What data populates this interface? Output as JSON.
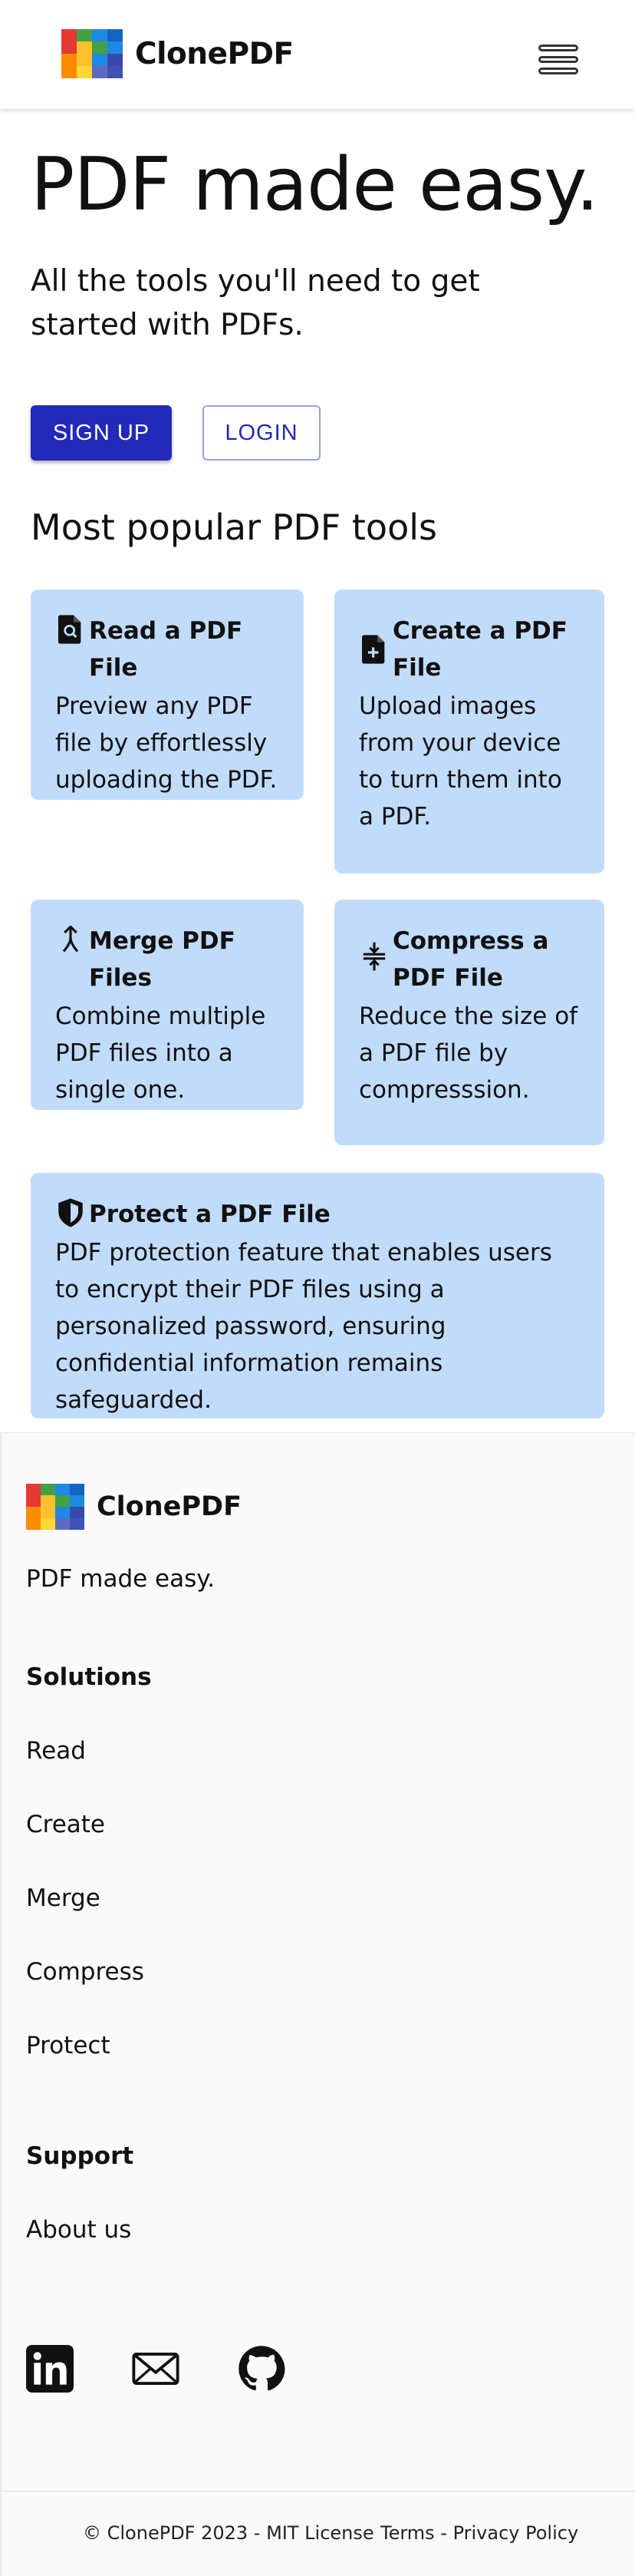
{
  "header": {
    "brand": "ClonePDF",
    "logo_colors": [
      "#e53935",
      "#43a047",
      "#1e88e5",
      "#1565c0",
      "#e53935",
      "#fbc02d",
      "#43a047",
      "#1e88e5",
      "#fb8c00",
      "#fbc02d",
      "#1e88e5",
      "#3949ab",
      "#fb8c00",
      "#fdd835",
      "#5c6bc0",
      "#3f51b5"
    ]
  },
  "hero": {
    "title": "PDF made easy.",
    "subtitle": "All the tools you'll need to get started with PDFs.",
    "signup_label": "SIGN UP",
    "login_label": "LOGIN"
  },
  "tools": {
    "section_title": "Most popular PDF tools",
    "items": [
      {
        "title": "Read a PDF File",
        "desc": "Preview any PDF file by effortlessly uploading the PDF.",
        "icon": "file-search-icon"
      },
      {
        "title": "Create a PDF File",
        "desc": "Upload images from your device to turn them into a PDF.",
        "icon": "file-plus-icon"
      },
      {
        "title": "Merge PDF Files",
        "desc": "Combine multiple PDF files into a single one.",
        "icon": "merge-icon"
      },
      {
        "title": "Compress a PDF File",
        "desc": "Reduce the size of a PDF file by compresssion.",
        "icon": "compress-icon"
      },
      {
        "title": "Protect a PDF File",
        "desc": "PDF protection feature that enables users to encrypt their PDF files using a personalized password, ensuring confidential information remains safeguarded.",
        "icon": "shield-icon"
      }
    ]
  },
  "footer": {
    "brand": "ClonePDF",
    "tagline": "PDF made easy.",
    "solutions_heading": "Solutions",
    "solutions": [
      "Read",
      "Create",
      "Merge",
      "Compress",
      "Protect"
    ],
    "support_heading": "Support",
    "support": [
      "About us"
    ],
    "social_icons": [
      "linkedin-icon",
      "mail-icon",
      "github-icon"
    ],
    "copyright": "© ClonePDF 2023 - MIT License",
    "terms": "Terms - Privacy Policy"
  }
}
